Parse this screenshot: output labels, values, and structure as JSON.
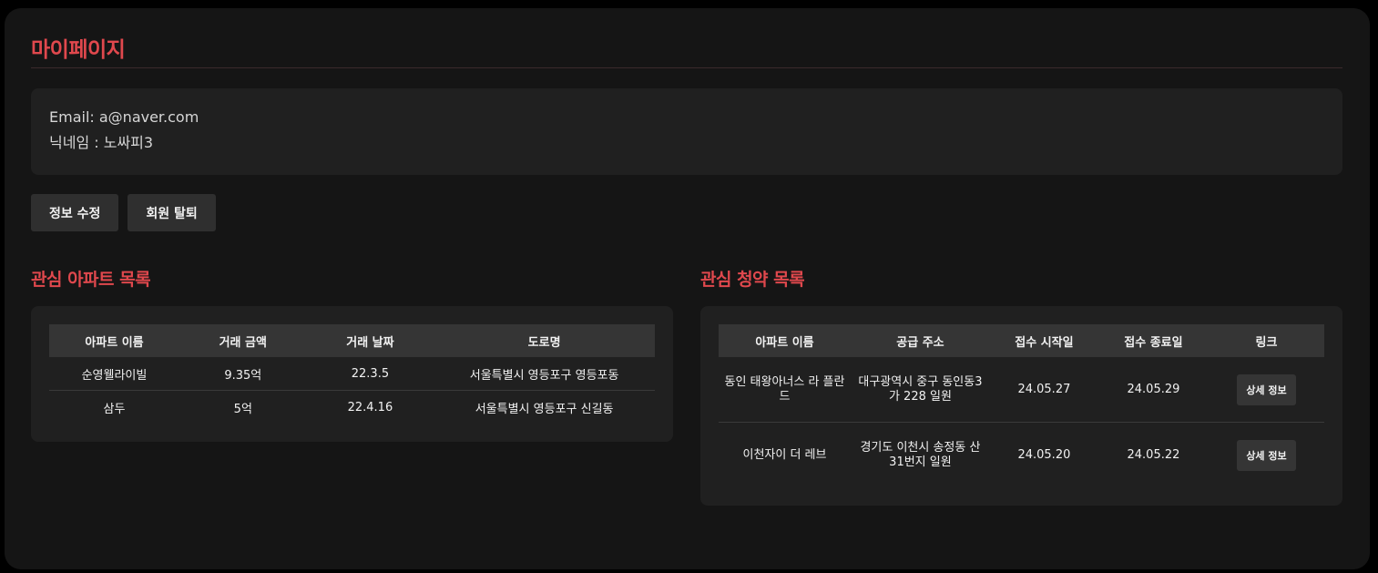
{
  "page": {
    "title": "마이페이지"
  },
  "profile": {
    "email_line": "Email: a@naver.com",
    "nickname_line": "닉네임 : 노싸피3"
  },
  "actions": {
    "edit_label": "정보 수정",
    "withdraw_label": "회원 탈퇴"
  },
  "favorite_apartments": {
    "title": "관심 아파트 목록",
    "columns": [
      "아파트 이름",
      "거래 금액",
      "거래 날짜",
      "도로명"
    ],
    "rows": [
      [
        "순영웰라이빌",
        "9.35억",
        "22.3.5",
        "서울특별시 영등포구 영등포동"
      ],
      [
        "삼두",
        "5억",
        "22.4.16",
        "서울특별시 영등포구 신길동"
      ]
    ]
  },
  "favorite_subscriptions": {
    "title": "관심 청약 목록",
    "columns": [
      "아파트 이름",
      "공급 주소",
      "접수 시작일",
      "접수 종료일",
      "링크"
    ],
    "rows": [
      [
        "동인 태왕아너스 라 플란드",
        "대구광역시 중구 동인동3가 228 일원",
        "24.05.27",
        "24.05.29",
        "상세 정보"
      ],
      [
        "이천자이 더 레브",
        "경기도 이천시 송정동 산31번지 일원",
        "24.05.20",
        "24.05.22",
        "상세 정보"
      ]
    ]
  },
  "colors": {
    "accent": "#e0484d",
    "page_bg": "#151515",
    "card_bg": "#202020",
    "header_bg": "#353535"
  }
}
